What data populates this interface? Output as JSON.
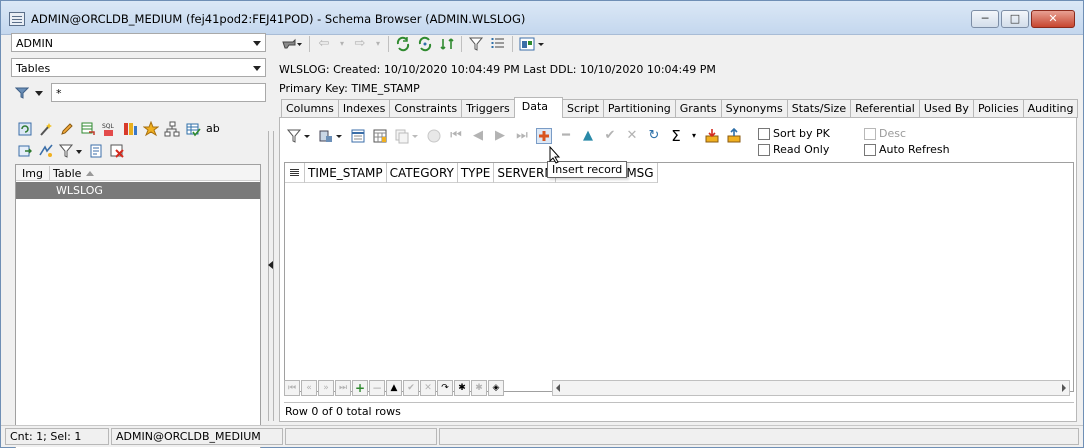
{
  "window": {
    "title": "ADMIN@ORCLDB_MEDIUM (fej41pod2:FEJ41POD) - Schema Browser (ADMIN.WLSLOG)",
    "minimize": "─",
    "maximize": "□",
    "close": "✕"
  },
  "left": {
    "schema_combo": "ADMIN",
    "type_combo": "Tables",
    "filter_value": "*",
    "table_headers": {
      "img": "Img",
      "table": "Table"
    },
    "rows": [
      {
        "name": "WLSLOG"
      }
    ],
    "icons_row1": [
      "refresh-icon",
      "wand-icon",
      "pencil-icon",
      "table-copy-icon",
      "sql-icon",
      "red-columns-icon",
      "star-icon",
      "hierarchy-icon",
      "grid-check-icon",
      "ab-icon"
    ],
    "icons_row2": [
      "export-icon",
      "transform-icon",
      "filter-icon",
      "report-icon",
      "delete-icon"
    ],
    "ab_label": "ab"
  },
  "right": {
    "info_line": "WLSLOG:  Created: 10/10/2020 10:04:49 PM   Last DDL: 10/10/2020 10:04:49 PM",
    "primary_key": "Primary Key:  TIME_STAMP",
    "tabs": [
      "Columns",
      "Indexes",
      "Constraints",
      "Triggers",
      "Data",
      "Script",
      "Partitioning",
      "Grants",
      "Synonyms",
      "Stats/Size",
      "Referential",
      "Used By",
      "Policies",
      "Auditing"
    ],
    "active_tab": "Data",
    "data": {
      "checkboxes": {
        "sort_by_pk": "Sort by PK",
        "read_only": "Read Only",
        "desc": "Desc",
        "auto_refresh": "Auto Refresh"
      },
      "columns": [
        "TIME_STAMP",
        "CATEGORY",
        "TYPE",
        "SERVERNA",
        "MSG"
      ],
      "tooltip": "Insert record",
      "row_count": "Row 0 of 0 total rows"
    }
  },
  "status": {
    "count": "Cnt: 1; Sel: 1",
    "connection": "ADMIN@ORCLDB_MEDIUM"
  },
  "colors": {
    "selected_row": "#7a7a7a",
    "insert_record": "#d9541e",
    "titlebar": "#c4d7ee"
  }
}
